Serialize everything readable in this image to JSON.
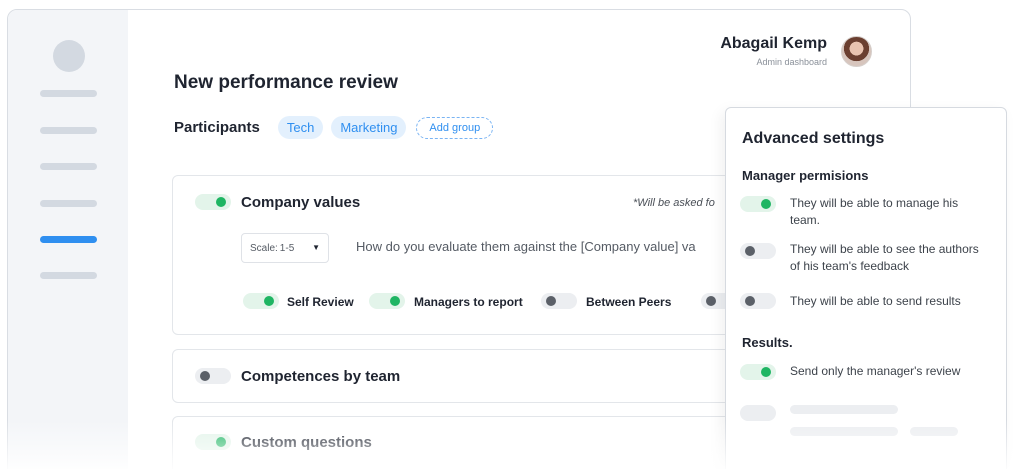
{
  "user": {
    "name": "Abagail Kemp",
    "role": "Admin dashboard"
  },
  "page": {
    "title": "New performance review"
  },
  "participants": {
    "label": "Participants",
    "groups": [
      "Tech",
      "Marketing"
    ],
    "add_label": "Add group"
  },
  "sections": [
    {
      "title": "Company values",
      "enabled": true,
      "note": "*Will be asked fo",
      "scale_label": "Scale:",
      "scale_value": "1-5",
      "question": "How do you evaluate them against the [Company value] va",
      "options": [
        {
          "label": "Self Review",
          "enabled": true
        },
        {
          "label": "Managers to report",
          "enabled": true
        },
        {
          "label": "Between Peers",
          "enabled": false
        }
      ]
    },
    {
      "title": "Competences by team",
      "enabled": false
    },
    {
      "title": "Custom questions",
      "enabled": true
    }
  ],
  "advanced": {
    "title": "Advanced settings",
    "manager_title": "Manager permisions",
    "permissions": [
      {
        "text": "They will be able to manage his team.",
        "enabled": true
      },
      {
        "text": "They will be able to see the authors of his team's feedback",
        "enabled": false
      },
      {
        "text": "They will be able to send results",
        "enabled": false
      }
    ],
    "results_title": "Results.",
    "results": [
      {
        "text": "Send only the manager's review",
        "enabled": true
      }
    ]
  },
  "icons": {
    "dropdown": "chevron-down-icon"
  },
  "colors": {
    "accent": "#2f8ff0",
    "toggle_on": "#1fb563",
    "toggle_off": "#5b6068"
  }
}
